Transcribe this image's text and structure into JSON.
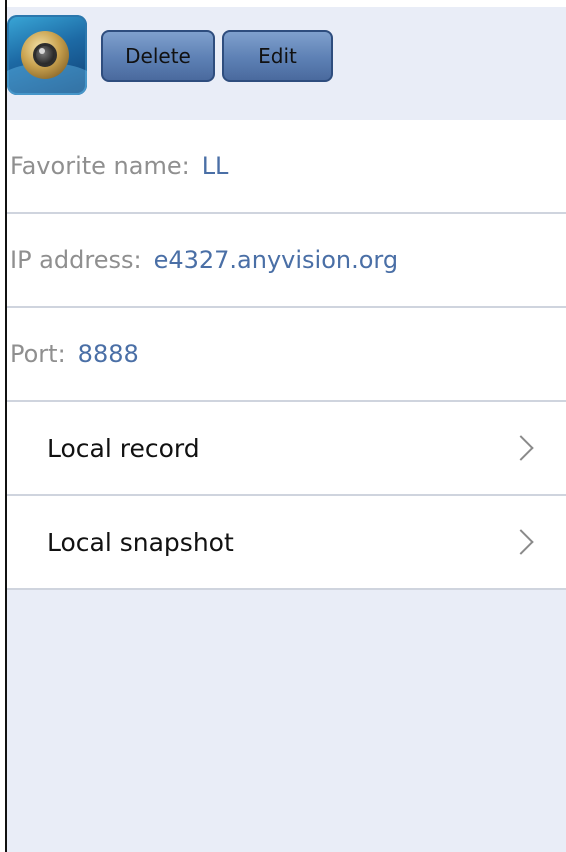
{
  "toolbar": {
    "app_icon": "camera-lens-icon",
    "delete_label": "Delete",
    "edit_label": "Edit"
  },
  "details": {
    "favorite_name_label": "Favorite name:",
    "favorite_name_value": "LL",
    "ip_label": "IP address:",
    "ip_value": "e4327.anyvision.org",
    "port_label": "Port:",
    "port_value": "8888"
  },
  "menu": {
    "items": [
      {
        "label": "Local record",
        "icon": "chevron-right-icon"
      },
      {
        "label": "Local snapshot",
        "icon": "chevron-right-icon"
      }
    ]
  },
  "colors": {
    "background": "#e9edf7",
    "value_text": "#4a6fa6",
    "label_text": "#8f8f8f",
    "button": "#5d80b4"
  }
}
